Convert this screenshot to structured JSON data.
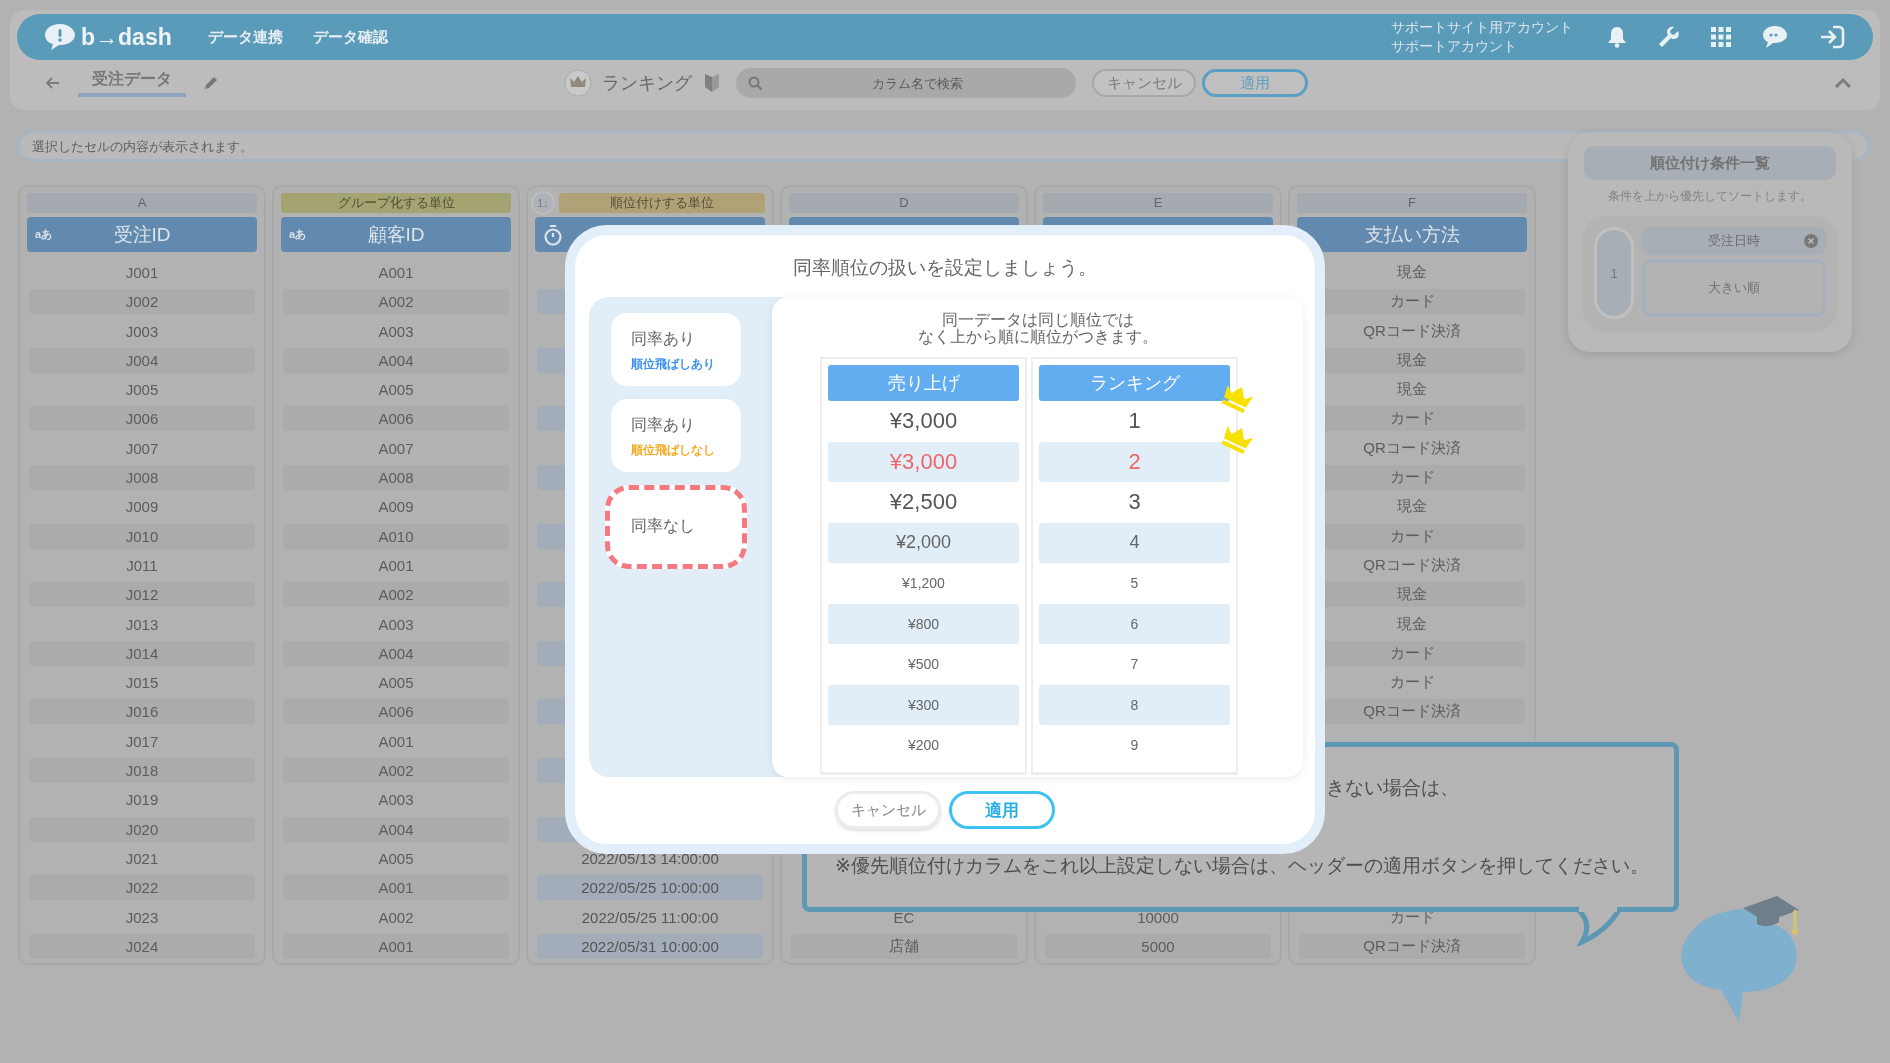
{
  "header": {
    "logo": "b→dash",
    "nav": [
      "データ連携",
      "データ確認"
    ],
    "account": [
      "サポートサイト用アカウント",
      "サポートアカウント"
    ]
  },
  "toolbar": {
    "page_title": "受注データ",
    "mode": "ランキング",
    "search": {
      "placeholder": "カラム名で検索"
    },
    "buttons": [
      "キャンセル",
      "適用"
    ]
  },
  "cell_viewer": {
    "placeholder": "選択したセルの内容が表示されます。"
  },
  "columns": [
    {
      "kind": "plain",
      "letter": "A",
      "type_label": "aあ",
      "title": "受注ID",
      "top_cells": [
        "J001",
        "J002",
        "J003",
        "J004",
        "J005",
        "J006",
        "J007",
        "J008",
        "J009",
        "J010",
        "J011",
        "J012",
        "J013",
        "J014",
        "J015",
        "J016",
        "J017",
        "J018",
        "J019",
        "J020",
        "J021",
        "J022",
        "J023",
        "J024"
      ]
    },
    {
      "kind": "group",
      "label": "グループ化する単位",
      "type_label": "aあ",
      "title": "顧客ID",
      "top_cells": [
        "A001",
        "A002",
        "A003",
        "A004",
        "A005",
        "A006",
        "A007",
        "A008",
        "A009",
        "A010",
        "A001",
        "A002",
        "A003",
        "A004",
        "A005",
        "A006",
        "A001",
        "A002",
        "A003",
        "A004",
        "A005",
        "A001",
        "A002",
        "A001"
      ]
    },
    {
      "kind": "rank",
      "badge": "1↓",
      "label": "順位付けする単位",
      "bottom_cells": [
        "2022/05/13 14:00:00",
        "2022/05/25 10:00:00",
        "2022/05/25 11:00:00",
        "2022/05/31 10:00:00"
      ]
    },
    {
      "kind": "plain",
      "letter": "D",
      "bottom_cells": [
        "EC",
        "店舗"
      ]
    },
    {
      "kind": "plain",
      "letter": "E",
      "bottom_cells": [
        "10000",
        "5000"
      ]
    },
    {
      "kind": "plain",
      "letter": "F",
      "title": "支払い方法",
      "top_cells": [
        "現金",
        "カード",
        "QRコード決済",
        "現金",
        "現金",
        "カード",
        "QRコード決済",
        "カード",
        "現金",
        "カード",
        "QRコード決済",
        "現金",
        "現金",
        "カード",
        "カード",
        "QRコード決済"
      ],
      "bottom_cells": [
        "カード",
        "QRコード決済"
      ]
    }
  ],
  "ranking_conditions": {
    "title": "順位付け条件一覧",
    "note": "条件を上から優先してソートします。",
    "items": [
      {
        "number": "1",
        "column": "受注日時",
        "order": "大きい順"
      }
    ]
  },
  "dialog": {
    "title": "同率順位の扱いを設定しましょう。",
    "options": [
      {
        "title": "同率あり",
        "subtitle": "順位飛ばしあり",
        "color": "#3a8ff0",
        "selected": false
      },
      {
        "title": "同率あり",
        "subtitle": "順位飛ばしなし",
        "color": "#f5a91c",
        "selected": false
      },
      {
        "title": "同率なし",
        "selected": true
      }
    ],
    "description": [
      "同一データは同じ順位では",
      "なく上から順に順位がつきます。"
    ],
    "table": {
      "columns": [
        "売り上げ",
        "ランキング"
      ],
      "rows": [
        {
          "sales": "¥3,000",
          "rank": "1",
          "kind": "large",
          "highlight": false,
          "crowned": true
        },
        {
          "sales": "¥3,000",
          "rank": "2",
          "kind": "large",
          "highlight": true,
          "crowned": true
        },
        {
          "sales": "¥2,500",
          "rank": "3",
          "kind": "large",
          "highlight": false,
          "crowned": false
        },
        {
          "sales": "¥2,000",
          "rank": "4",
          "kind": "medium",
          "highlight": false,
          "crowned": false
        },
        {
          "sales": "¥1,200",
          "rank": "5",
          "kind": "small",
          "highlight": false,
          "crowned": false
        },
        {
          "sales": "¥800",
          "rank": "6",
          "kind": "small",
          "highlight": false,
          "crowned": false
        },
        {
          "sales": "¥500",
          "rank": "7",
          "kind": "small",
          "highlight": false,
          "crowned": false
        },
        {
          "sales": "¥300",
          "rank": "8",
          "kind": "small",
          "highlight": false,
          "crowned": false
        },
        {
          "sales": "¥200",
          "rank": "9",
          "kind": "small",
          "highlight": false,
          "crowned": false
        }
      ]
    },
    "buttons": [
      "キャンセル",
      "適用"
    ]
  },
  "hint": {
    "lines": [
      "きない場合は、",
      "※優先順位付けカラムをこれ以上設定しない場合は、ヘッダーの適用ボタンを押してください。"
    ]
  }
}
